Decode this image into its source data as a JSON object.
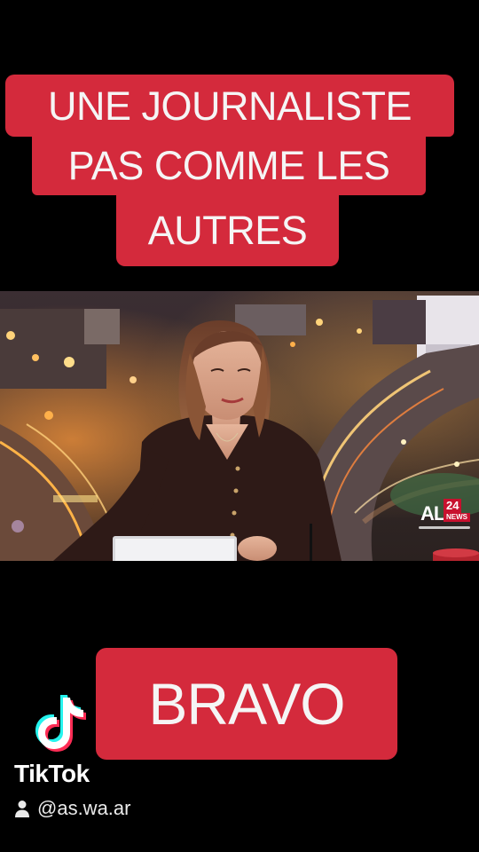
{
  "caption": {
    "lines": [
      "UNE JOURNALISTE",
      "PAS COMME LES",
      "AUTRES"
    ]
  },
  "video": {
    "channel_logo": {
      "al": "AL",
      "number": "24",
      "news": "NEWS"
    }
  },
  "bottom_caption": "BRAVO",
  "watermark": {
    "app_name": "TikTok",
    "username": "@as.wa.ar",
    "icons": [
      "tiktok-logo-icon",
      "person-icon"
    ]
  },
  "colors": {
    "caption_bg": "#d42a3c",
    "caption_text": "#f5f5f5",
    "background": "#000000",
    "tiktok_cyan": "#25f4ee",
    "tiktok_pink": "#fe2c55"
  }
}
